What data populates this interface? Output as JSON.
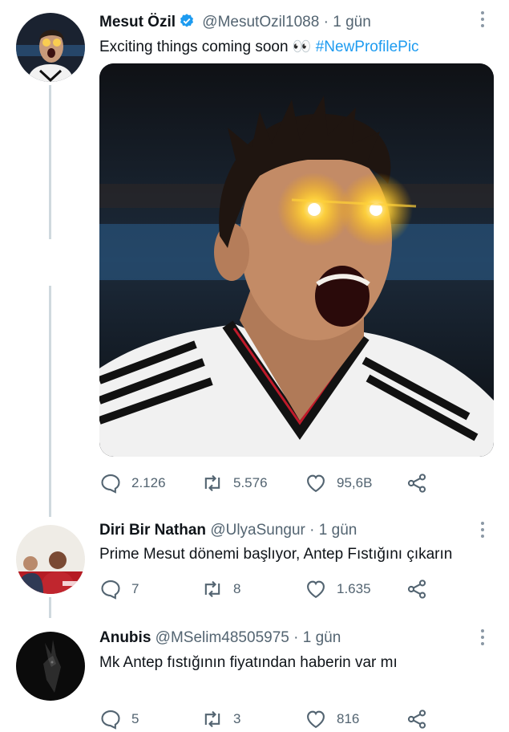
{
  "tweets": [
    {
      "name": "Mesut Özil",
      "handle": "@MesutOzil1088",
      "dot": "·",
      "time": "1 gün",
      "text": "Exciting things coming soon 👀",
      "hashtag": "#NewProfilePic",
      "counts": {
        "reply": "2.126",
        "retweet": "5.576",
        "like": "95,6B"
      }
    },
    {
      "name": "Diri Bir Nathan",
      "handle": "@UlyaSungur",
      "dot": "·",
      "time": "1 gün",
      "text": "Prime Mesut dönemi başlıyor, Antep Fıstığını çıkarın",
      "counts": {
        "reply": "7",
        "retweet": "8",
        "like": "1.635"
      }
    },
    {
      "name": "Anubis",
      "handle": "@MSelim48505975",
      "dot": "·",
      "time": "1 gün",
      "text": "Mk Antep fıstığının fiyatından haberin var mı",
      "counts": {
        "reply": "5",
        "retweet": "3",
        "like": "816"
      }
    }
  ],
  "colors": {
    "accent": "#1d9bf0",
    "muted": "#536471",
    "line": "#cfd9de"
  },
  "icons": [
    "verified-badge-icon",
    "more-options-icon",
    "reply-icon",
    "retweet-icon",
    "like-icon",
    "share-icon"
  ]
}
